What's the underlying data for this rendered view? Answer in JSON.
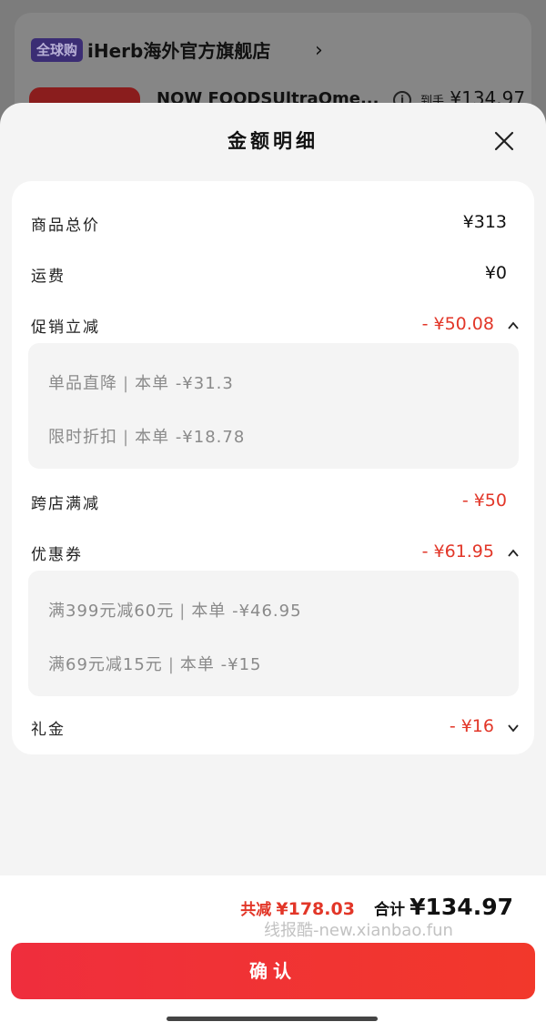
{
  "background": {
    "badge": "全球购",
    "store_name": "iHerb海外官方旗舰店",
    "chevron": "›",
    "product_name": "NOW FOODSUltraOme...",
    "info_icon": "info-icon",
    "price_label": "到手",
    "price": "¥134.97"
  },
  "sheet": {
    "title": "金额明细",
    "close_icon": "close-icon"
  },
  "rows": {
    "goods_total": {
      "label": "商品总价",
      "value": "¥313"
    },
    "shipping": {
      "label": "运费",
      "value": "¥0"
    },
    "promo": {
      "label": "促销立减",
      "value": "- ¥50.08",
      "expanded": true
    },
    "promo_items": [
      {
        "name": "单品直降",
        "sep": "|",
        "scope": "本单",
        "amount": "-¥31.3"
      },
      {
        "name": "限时折扣",
        "sep": "|",
        "scope": "本单",
        "amount": "-¥18.78"
      }
    ],
    "cross_store": {
      "label": "跨店满减",
      "value": "- ¥50"
    },
    "coupon": {
      "label": "优惠券",
      "value": "- ¥61.95",
      "expanded": true
    },
    "coupon_items": [
      {
        "name": "满399元减60元",
        "sep": "|",
        "scope": "本单",
        "amount": "-¥46.95"
      },
      {
        "name": "满69元减15元",
        "sep": "|",
        "scope": "本单",
        "amount": "-¥15"
      }
    ],
    "gift": {
      "label": "礼金",
      "value": "- ¥16",
      "expanded": false
    }
  },
  "footer": {
    "reduce_label": "共减",
    "reduce_value": "¥178.03",
    "sum_label": "合计",
    "sum_value": "¥134.97",
    "watermark": "线报酷-new.xianbao.fun",
    "confirm": "确认"
  },
  "colors": {
    "accent_red": "#e23628",
    "button_red": "#ef2e3d"
  }
}
